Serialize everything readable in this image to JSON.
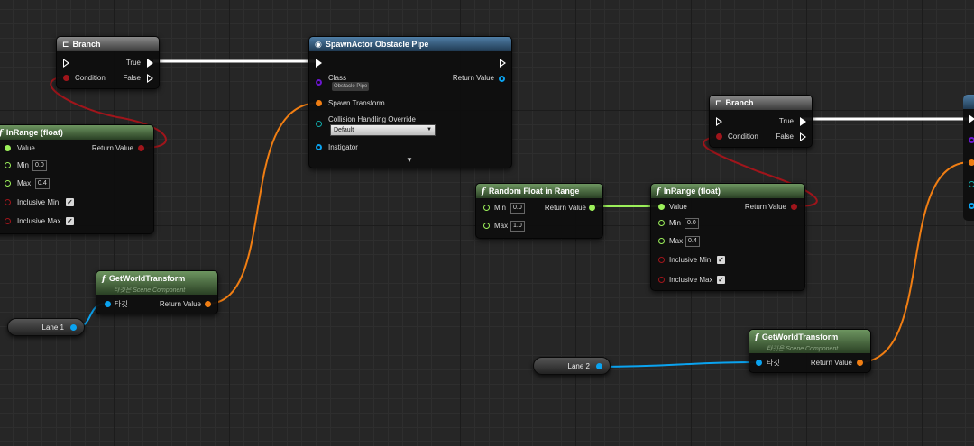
{
  "colors": {
    "exec": "#ffffff",
    "float": "#9cf05a",
    "bool": "#a0151b",
    "transform": "#f07e13",
    "object": "#0aa3f0",
    "class": "#6a16ce"
  },
  "branch1": {
    "title": "Branch",
    "true_label": "True",
    "condition_label": "Condition",
    "false_label": "False"
  },
  "inrange1": {
    "title": "InRange (float)",
    "value_label": "Value",
    "return_label": "Return Value",
    "min_label": "Min",
    "min_value": "0.0",
    "max_label": "Max",
    "max_value": "0.4",
    "incl_min_label": "Inclusive Min",
    "incl_max_label": "Inclusive Max",
    "incl_min_checked": true,
    "incl_max_checked": true
  },
  "spawn": {
    "title": "SpawnActor Obstacle Pipe",
    "class_label": "Class",
    "class_value": "Obstacle Pipe",
    "return_label": "Return Value",
    "spawn_transform_label": "Spawn Transform",
    "collision_label": "Collision Handling Override",
    "collision_value": "Default",
    "instigator_label": "Instigator"
  },
  "gwt1": {
    "title": "GetWorldTransform",
    "subtitle": "타깃은 Scene Component",
    "target_label": "타깃",
    "return_label": "Return Value"
  },
  "lane1": {
    "label": "Lane 1"
  },
  "branch2": {
    "title": "Branch",
    "true_label": "True",
    "condition_label": "Condition",
    "false_label": "False"
  },
  "random": {
    "title": "Random Float in Range",
    "min_label": "Min",
    "min_value": "0.0",
    "max_label": "Max",
    "max_value": "1.0",
    "return_label": "Return Value"
  },
  "inrange2": {
    "title": "InRange (float)",
    "value_label": "Value",
    "return_label": "Return Value",
    "min_label": "Min",
    "min_value": "0.0",
    "max_label": "Max",
    "max_value": "0.4",
    "incl_min_label": "Inclusive Min",
    "incl_max_label": "Inclusive Max",
    "incl_min_checked": true,
    "incl_max_checked": true
  },
  "gwt2": {
    "title": "GetWorldTransform",
    "subtitle": "타깃은 Scene Component",
    "target_label": "타깃",
    "return_label": "Return Value"
  },
  "lane2": {
    "label": "Lane 2"
  },
  "icons": [
    "branch-icon",
    "function-icon",
    "spawn-icon",
    "exec-pin-icon",
    "data-pin-icon",
    "checkbox-icon",
    "dropdown-arrow-icon",
    "expand-arrow-icon"
  ]
}
